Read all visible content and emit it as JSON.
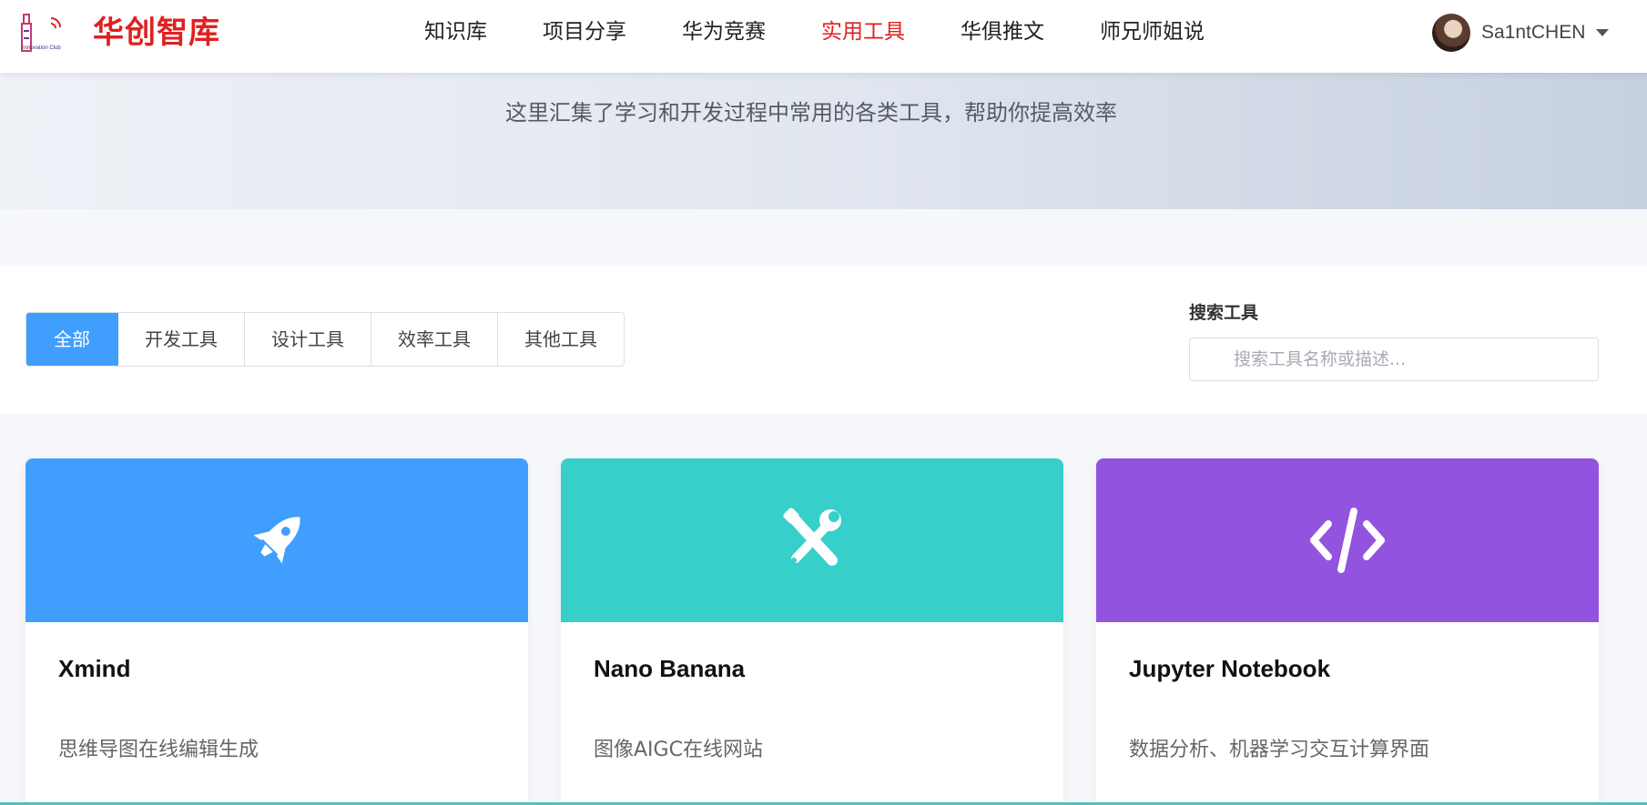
{
  "header": {
    "brand": "华创智库",
    "logo_icon": "innovation-club-logo",
    "nav": [
      {
        "label": "知识库",
        "active": false
      },
      {
        "label": "项目分享",
        "active": false
      },
      {
        "label": "华为竞赛",
        "active": false
      },
      {
        "label": "实用工具",
        "active": true
      },
      {
        "label": "华俱推文",
        "active": false
      },
      {
        "label": "师兄师姐说",
        "active": false
      }
    ],
    "user": {
      "name": "Sa1ntCHEN",
      "avatar_icon": "avatar",
      "menu_icon": "caret-down-icon"
    }
  },
  "hero": {
    "subtitle": "这里汇集了学习和开发过程中常用的各类工具，帮助你提高效率"
  },
  "filters": {
    "tabs": [
      {
        "label": "全部",
        "active": true
      },
      {
        "label": "开发工具",
        "active": false
      },
      {
        "label": "设计工具",
        "active": false
      },
      {
        "label": "效率工具",
        "active": false
      },
      {
        "label": "其他工具",
        "active": false
      }
    ],
    "search_label": "搜索工具",
    "search_placeholder": "搜索工具名称或描述...",
    "search_value": ""
  },
  "tools": [
    {
      "name": "Xmind",
      "desc": "思维导图在线编辑生成",
      "icon": "rocket-icon",
      "color": "#409eff"
    },
    {
      "name": "Nano Banana",
      "desc": "图像AIGC在线网站",
      "icon": "tools-icon",
      "color": "#36cfc9"
    },
    {
      "name": "Jupyter Notebook",
      "desc": "数据分析、机器学习交互计算界面",
      "icon": "code-icon",
      "color": "#9254de"
    }
  ],
  "colors": {
    "brand": "#e02020",
    "accent": "#409eff"
  }
}
